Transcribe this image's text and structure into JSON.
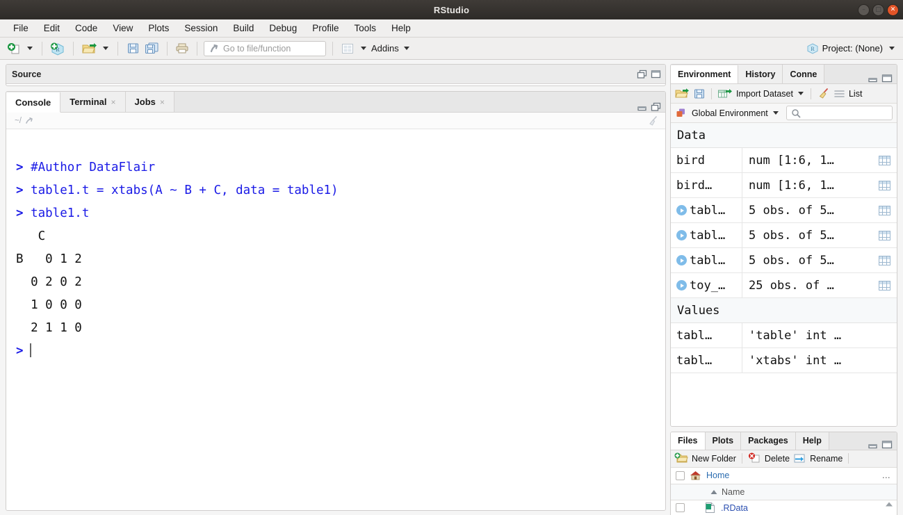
{
  "window": {
    "title": "RStudio",
    "buttons": {
      "minimize": "–",
      "maximize": "□",
      "close": "✕"
    }
  },
  "menubar": {
    "items": [
      "File",
      "Edit",
      "Code",
      "View",
      "Plots",
      "Session",
      "Build",
      "Debug",
      "Profile",
      "Tools",
      "Help"
    ]
  },
  "toolbar": {
    "new_file_icon": "new-file-icon",
    "new_project_icon": "new-project-icon",
    "open_file_icon": "open-folder-icon",
    "save_icon": "save-icon",
    "save_all_icon": "save-all-icon",
    "print_icon": "print-icon",
    "goto_placeholder": "Go to file/function",
    "goto_value": "",
    "panes_icon": "panes-layout-icon",
    "addins_label": "Addins",
    "project_label": "Project: (None)",
    "project_icon": "r-project-icon"
  },
  "source_pane": {
    "title": "Source",
    "restore_icon": "restore-pane-icon",
    "maximize_icon": "maximize-pane-icon"
  },
  "console_pane": {
    "tabs": [
      {
        "label": "Console",
        "closable": false,
        "active": true
      },
      {
        "label": "Terminal",
        "closable": true,
        "active": false
      },
      {
        "label": "Jobs",
        "closable": true,
        "active": false
      }
    ],
    "close_glyph": "×",
    "path": "~/",
    "path_icon": "open-in-new-window-icon",
    "clear_icon": "broom-icon",
    "minimize_icon": "minimize-pane-icon",
    "maximize_icon": "maximize-pane-icon",
    "lines": [
      {
        "type": "input",
        "prompt": "> ",
        "text": "#Author DataFlair"
      },
      {
        "type": "input",
        "prompt": "> ",
        "text": "table1.t = xtabs(A ~ B + C, data = table1)"
      },
      {
        "type": "input",
        "prompt": "> ",
        "text": "table1.t"
      },
      {
        "type": "output",
        "prompt": "",
        "text": "   C"
      },
      {
        "type": "output",
        "prompt": "",
        "text": "B   0 1 2"
      },
      {
        "type": "output",
        "prompt": "",
        "text": "  0 2 0 2"
      },
      {
        "type": "output",
        "prompt": "",
        "text": "  1 0 0 0"
      },
      {
        "type": "output",
        "prompt": "",
        "text": "  2 1 1 0"
      }
    ],
    "final_prompt": ">"
  },
  "environment_pane": {
    "tabs": [
      {
        "label": "Environment",
        "active": true
      },
      {
        "label": "History",
        "active": false
      },
      {
        "label": "Conne",
        "active": false
      }
    ],
    "minimize_icon": "minimize-pane-icon",
    "maximize_icon": "maximize-pane-icon",
    "toolbar": {
      "load_icon": "open-folder-icon",
      "save_icon": "save-icon",
      "import_icon": "import-dataset-icon",
      "import_label": "Import Dataset",
      "clear_icon": "broom-icon",
      "list_icon": "list-view-icon",
      "list_label": "List"
    },
    "scope": {
      "icon": "global-environment-icon",
      "label": "Global Environment",
      "search_icon": "search-icon",
      "search_value": "",
      "search_placeholder": ""
    },
    "groups": [
      {
        "name": "Data",
        "rows": [
          {
            "name": "bird",
            "value": "num [1:6, 1…",
            "expandable": false,
            "grid": true
          },
          {
            "name": "bird…",
            "value": "num [1:6, 1…",
            "expandable": false,
            "grid": true
          },
          {
            "name": "tabl…",
            "value": "5 obs. of 5…",
            "expandable": true,
            "grid": true
          },
          {
            "name": "tabl…",
            "value": "5 obs. of 5…",
            "expandable": true,
            "grid": true
          },
          {
            "name": "tabl…",
            "value": "5 obs. of 5…",
            "expandable": true,
            "grid": true
          },
          {
            "name": "toy_…",
            "value": "25 obs. of …",
            "expandable": true,
            "grid": true
          }
        ]
      },
      {
        "name": "Values",
        "rows": [
          {
            "name": "tabl…",
            "value": "'table' int …",
            "expandable": false,
            "grid": false
          },
          {
            "name": "tabl…",
            "value": "'xtabs' int …",
            "expandable": false,
            "grid": false
          }
        ]
      }
    ]
  },
  "files_pane": {
    "tabs": [
      {
        "label": "Files",
        "active": true
      },
      {
        "label": "Plots",
        "active": false
      },
      {
        "label": "Packages",
        "active": false
      },
      {
        "label": "Help",
        "active": false
      }
    ],
    "minimize_icon": "minimize-pane-icon",
    "maximize_icon": "maximize-pane-icon",
    "toolbar": {
      "new_folder_icon": "new-folder-icon",
      "new_folder_label": "New Folder",
      "delete_icon": "delete-icon",
      "delete_label": "Delete",
      "rename_icon": "rename-icon",
      "rename_label": "Rename"
    },
    "breadcrumb": {
      "home_icon": "home-icon",
      "home_label": "Home",
      "more_label": "…"
    },
    "columns": [
      {
        "label": "Name",
        "sort_icon": "sort-ascending-icon"
      }
    ],
    "rows": [
      {
        "name": ".RData",
        "icon": "rdata-file-icon"
      }
    ],
    "scroll_up_icon": "scroll-up-icon"
  }
}
